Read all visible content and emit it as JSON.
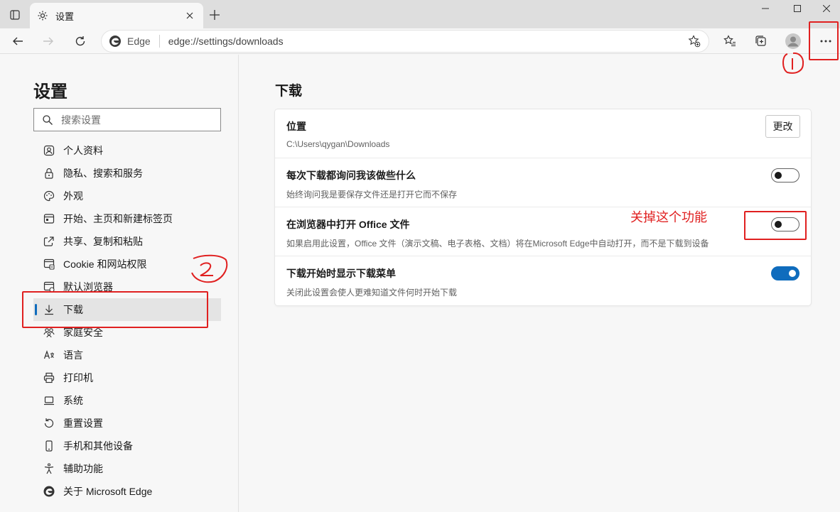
{
  "tab": {
    "title": "设置"
  },
  "toolbar": {
    "site_name": "Edge",
    "url": "edge://settings/downloads"
  },
  "sidebar": {
    "title": "设置",
    "search_placeholder": "搜索设置",
    "items": [
      {
        "label": "个人资料",
        "icon": "profile-icon"
      },
      {
        "label": "隐私、搜索和服务",
        "icon": "lock-icon"
      },
      {
        "label": "外观",
        "icon": "palette-icon"
      },
      {
        "label": "开始、主页和新建标签页",
        "icon": "home-icon"
      },
      {
        "label": "共享、复制和粘贴",
        "icon": "share-icon"
      },
      {
        "label": "Cookie 和网站权限",
        "icon": "site-permissions-icon"
      },
      {
        "label": "默认浏览器",
        "icon": "browser-icon"
      },
      {
        "label": "下载",
        "icon": "download-icon",
        "active": true
      },
      {
        "label": "家庭安全",
        "icon": "family-icon"
      },
      {
        "label": "语言",
        "icon": "language-icon"
      },
      {
        "label": "打印机",
        "icon": "printer-icon"
      },
      {
        "label": "系统",
        "icon": "laptop-icon"
      },
      {
        "label": "重置设置",
        "icon": "reset-icon"
      },
      {
        "label": "手机和其他设备",
        "icon": "phone-icon"
      },
      {
        "label": "辅助功能",
        "icon": "accessibility-icon"
      },
      {
        "label": "关于 Microsoft Edge",
        "icon": "edge-logo-icon"
      }
    ]
  },
  "main": {
    "title": "下载",
    "location": {
      "label": "位置",
      "path": "C:\\Users\\qygan\\Downloads",
      "button": "更改"
    },
    "ask_each": {
      "label": "每次下载都询问我该做些什么",
      "desc": "始终询问我是要保存文件还是打开它而不保存",
      "on": false
    },
    "office": {
      "label": "在浏览器中打开 Office 文件",
      "desc": "如果启用此设置，Office 文件（演示文稿、电子表格、文档）将在Microsoft Edge中自动打开，而不是下载到设备",
      "on": false
    },
    "show_menu": {
      "label": "下载开始时显示下载菜单",
      "desc": "关闭此设置会使人更难知道文件何时开始下载",
      "on": true
    }
  },
  "annotations": {
    "note": "关掉这个功能"
  },
  "colors": {
    "accent": "#0f6cbd",
    "annotation": "#e02020"
  }
}
